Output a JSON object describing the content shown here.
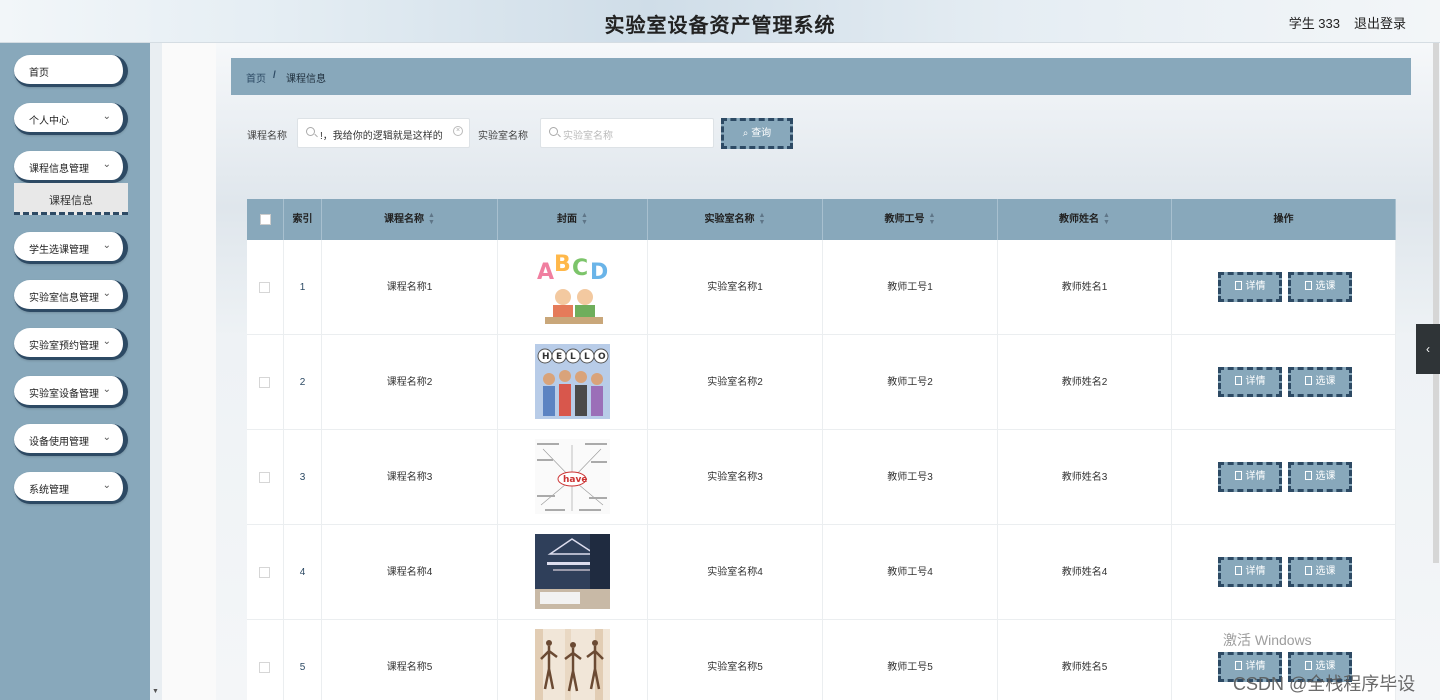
{
  "header": {
    "title": "实验室设备资产管理系统",
    "user": "学生 333",
    "logout": "退出登录"
  },
  "sidebar": {
    "items": [
      {
        "label": "首页",
        "has_chevron": false
      },
      {
        "label": "个人中心",
        "has_chevron": true
      },
      {
        "label": "课程信息管理",
        "has_chevron": true
      },
      {
        "label": "学生选课管理",
        "has_chevron": true
      },
      {
        "label": "实验室信息管理",
        "has_chevron": true
      },
      {
        "label": "实验室预约管理",
        "has_chevron": true
      },
      {
        "label": "实验室设备管理",
        "has_chevron": true
      },
      {
        "label": "设备使用管理",
        "has_chevron": true
      },
      {
        "label": "系统管理",
        "has_chevron": true
      }
    ],
    "submenu_active": "课程信息",
    "chevron_glyph": "⌄"
  },
  "breadcrumb": {
    "home": "首页",
    "separator": "/",
    "current": "课程信息"
  },
  "search": {
    "course_label": "课程名称",
    "course_value": "!，我给你的逻辑就是这样的",
    "lab_label": "实验室名称",
    "lab_placeholder": "实验室名称",
    "query_label": "查询"
  },
  "table": {
    "columns": [
      "索引",
      "课程名称",
      "封面",
      "实验室名称",
      "教师工号",
      "教师姓名",
      "操作"
    ],
    "sortable": [
      false,
      true,
      true,
      true,
      true,
      true,
      false
    ],
    "rows": [
      {
        "index": "1",
        "course": "课程名称1",
        "cover": "abcd-kids",
        "lab": "实验室名称1",
        "teacher_no": "教师工号1",
        "teacher_name": "教师姓名1"
      },
      {
        "index": "2",
        "course": "课程名称2",
        "cover": "hello-kids",
        "lab": "实验室名称2",
        "teacher_no": "教师工号2",
        "teacher_name": "教师姓名2"
      },
      {
        "index": "3",
        "course": "课程名称3",
        "cover": "word-cloud",
        "lab": "实验室名称3",
        "teacher_no": "教师工号3",
        "teacher_name": "教师姓名3"
      },
      {
        "index": "4",
        "course": "课程名称4",
        "cover": "business-book",
        "lab": "实验室名称4",
        "teacher_no": "教师工号4",
        "teacher_name": "教师姓名4"
      },
      {
        "index": "5",
        "course": "课程名称5",
        "cover": "dancers",
        "lab": "实验室名称5",
        "teacher_no": "教师工号5",
        "teacher_name": "教师姓名5"
      }
    ],
    "detail_label": "详情",
    "select_label": "选课"
  },
  "overlay": {
    "activate_windows": "激活 Windows",
    "csdn": "CSDN @全栈程序毕设"
  },
  "colors": {
    "accent": "#88a8bb",
    "border_dark": "#2d4a64"
  }
}
